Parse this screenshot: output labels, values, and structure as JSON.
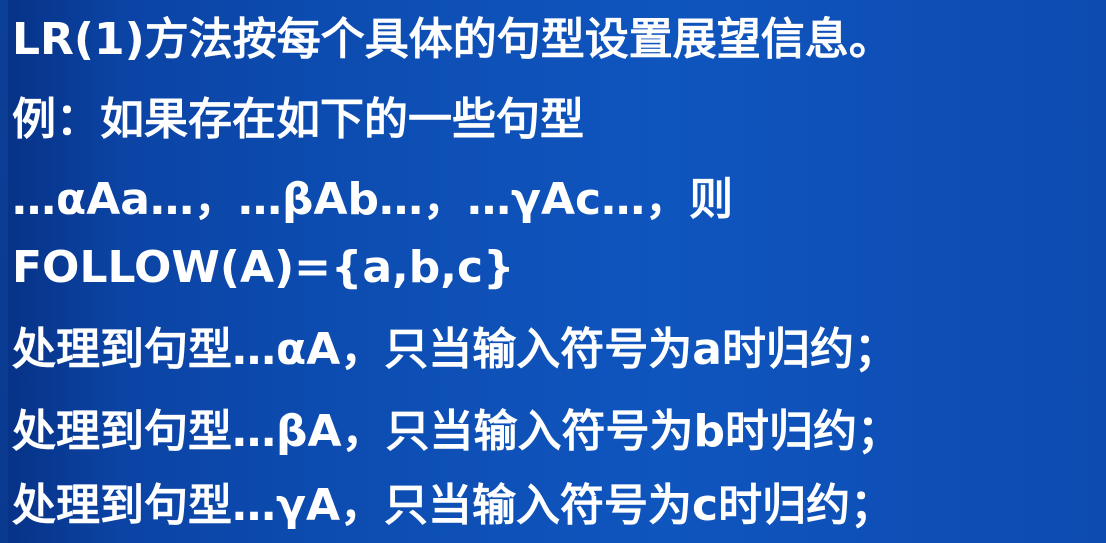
{
  "slide": {
    "lines": [
      "LR(1)方法按每个具体的句型设置展望信息。",
      "例：如果存在如下的一些句型",
      "…αAa…，…βAb…，…γAc…，则",
      "FOLLOW(A)={a,b,c}",
      "处理到句型…αA，只当输入符号为a时归约；",
      "处理到句型…βA，只当输入符号为b时归约；",
      "处理到句型…γA，只当输入符号为c时归约；"
    ]
  }
}
